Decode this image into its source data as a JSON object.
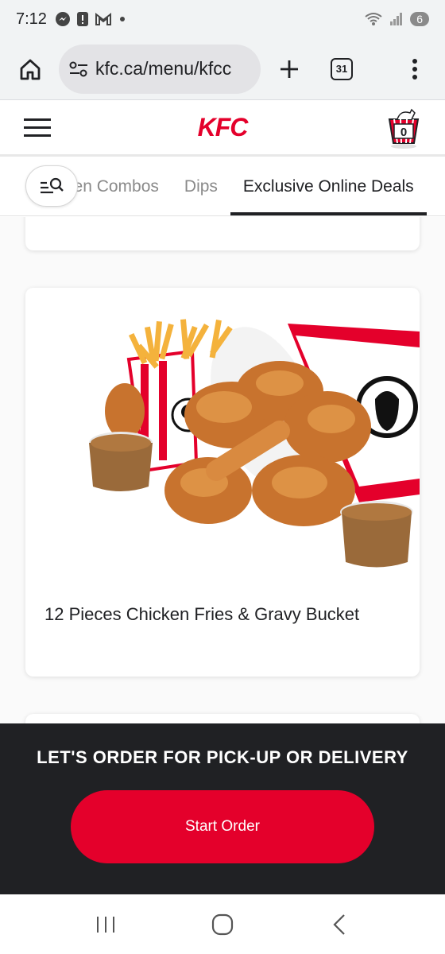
{
  "status_bar": {
    "time": "7:12",
    "battery_level": "6",
    "icons": [
      "messenger-icon",
      "alert-icon",
      "gmail-icon",
      "wifi-icon",
      "signal-icon"
    ]
  },
  "browser": {
    "url": "kfc.ca/menu/kfcc",
    "tab_count": "31",
    "icons": [
      "home-icon",
      "site-settings-icon",
      "new-tab-icon",
      "tabs-icon",
      "more-menu-icon"
    ]
  },
  "header": {
    "logo": "KFC",
    "cart_count": "0",
    "brand_color": "#e4002b"
  },
  "categories": {
    "tabs": [
      {
        "label": "Chicken Combos",
        "active": false
      },
      {
        "label": "Dips",
        "active": false
      },
      {
        "label": "Exclusive Online Deals",
        "active": true
      }
    ]
  },
  "menu": {
    "items": [
      {
        "title": "12 Pieces Chicken Fries & Gravy Bucket"
      }
    ]
  },
  "order_banner": {
    "title": "LET'S ORDER FOR PICK-UP OR DELIVERY",
    "button_label": "Start Order",
    "background_color": "#202124"
  }
}
